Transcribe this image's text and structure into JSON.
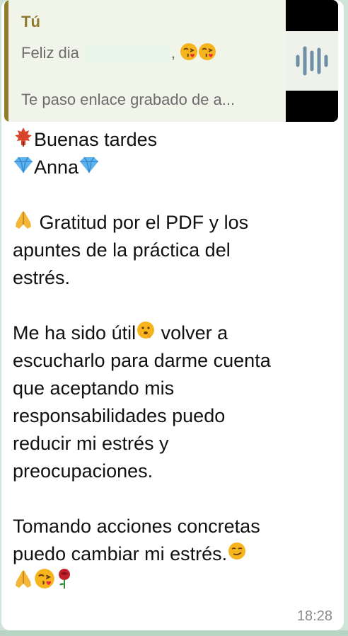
{
  "reply": {
    "author": "Tú",
    "line1": "Feliz dia",
    "line1_suffix": ",",
    "line2": "Te paso enlace grabado de a..."
  },
  "message": {
    "l1": "Buenas tardes",
    "l2": "Anna",
    "l3": " Gratitud por el PDF y los",
    "l4": "apuntes de la práctica del",
    "l5": "estrés.",
    "l6a": "Me ha sido útil",
    "l6b": " volver a",
    "l7": "escucharlo para darme cuenta",
    "l8": "que aceptando mis",
    "l9": "responsabilidades puedo",
    "l10": "reducir mi estrés y",
    "l11": "preocupaciones.",
    "l12": "Tomando acciones concretas",
    "l13": "puedo cambiar mi estrés."
  },
  "time": "18:28",
  "colors": {
    "accent": "#8f7b2e",
    "bubble": "#ffffff",
    "background": "#cfe3d6"
  },
  "icons": [
    "audio-waveform-icon",
    "maple-leaf-icon",
    "gem-icon",
    "folded-hands-icon",
    "kiss-face-icon",
    "thinking-face-icon",
    "smirk-face-icon",
    "rose-icon"
  ]
}
